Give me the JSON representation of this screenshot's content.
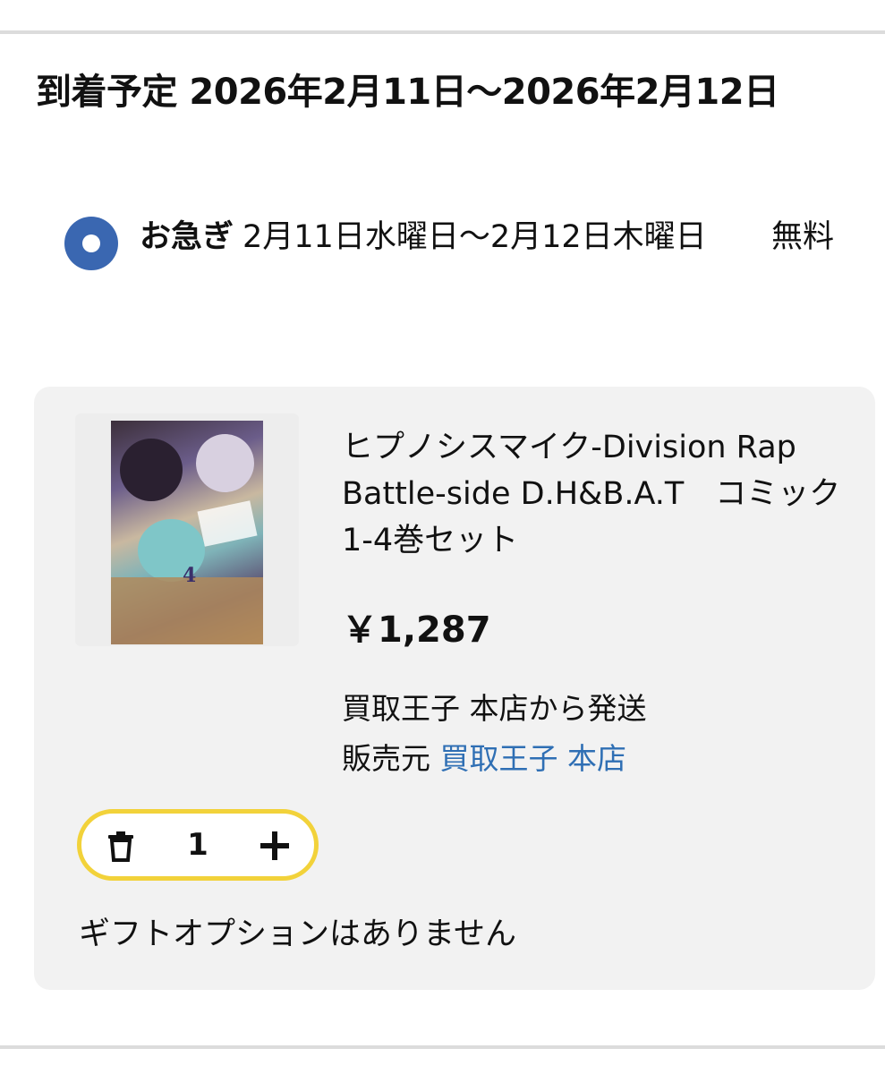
{
  "delivery": {
    "heading": "到着予定 2026年2月11日〜2026年2月12日"
  },
  "shipping_option": {
    "speed_label": "お急ぎ",
    "date_range": "2月11日水曜日〜2月12日木曜日",
    "price": "無料",
    "selected": true
  },
  "item": {
    "title": "ヒプノシスマイク-Division Rap Battle-side D.H&B.A.T　コミック　1-4巻セット",
    "price": "￥1,287",
    "ships_from": "買取王子 本店から発送",
    "seller_prefix": "販売元",
    "seller_name": "買取王子 本店",
    "cover_volume": "4",
    "quantity": "1"
  },
  "gift": {
    "text": "ギフトオプションはありません"
  },
  "colors": {
    "accent_blue": "#3a67b1",
    "link_blue": "#2f6fb4",
    "stepper_border": "#f2d23a",
    "card_bg": "#f2f2f2"
  },
  "icons": {
    "radio": "radio-selected-icon",
    "delete": "trash-icon",
    "increase": "plus-icon"
  }
}
